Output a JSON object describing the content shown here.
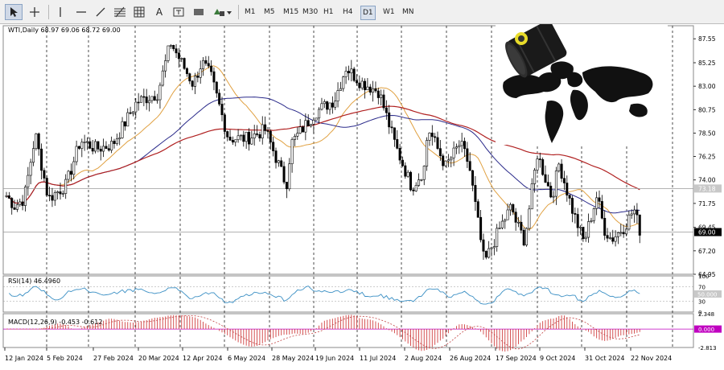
{
  "toolbar": {
    "icons": [
      "cursor-icon",
      "crosshair-icon",
      "vertical-line-icon",
      "horizontal-line-icon",
      "trendline-icon",
      "fibonacci-icon",
      "grid-icon",
      "text-icon",
      "text-label-icon",
      "rectangle-icon",
      "shapes-icon"
    ],
    "timeframes": [
      "M1",
      "M5",
      "M15",
      "M30",
      "H1",
      "H4",
      "D1",
      "W1",
      "MN"
    ],
    "active_timeframe": "D1"
  },
  "main": {
    "header": "WTI,Daily  68.97 69.06 68.72 69.00",
    "price_labels": [
      "87.55",
      "85.25",
      "83.00",
      "80.75",
      "78.50",
      "76.25",
      "74.00",
      "71.75",
      "69.45",
      "67.20",
      "64.95"
    ],
    "marker_label": "73.18",
    "current_label": "69.00"
  },
  "rsi": {
    "header": "RSI(14) 46.4960",
    "labels": [
      "100",
      "70",
      "50.000",
      "30",
      "0"
    ]
  },
  "macd": {
    "header": "MACD(12,26,9) -0.453 -0.612",
    "labels": [
      "2.348",
      "0.000",
      "-2.813"
    ]
  },
  "x_labels": [
    "12 Jan 2024",
    "5 Feb 2024",
    "27 Feb 2024",
    "20 Mar 2024",
    "12 Apr 2024",
    "6 May 2024",
    "28 May 2024",
    "19 Jun 2024",
    "11 Jul 2024",
    "2 Aug 2024",
    "26 Aug 2024",
    "17 Sep 2024",
    "9 Oct 2024",
    "31 Oct 2024",
    "22 Nov 2024"
  ],
  "colors": {
    "ma_orange": "#e0a040",
    "ma_blue": "#2a2a8a",
    "ma_red": "#b02020",
    "rsi": "#3a8fc4",
    "macd_hist": "#d04040",
    "macd_signal": "#c04040"
  },
  "chart_data": {
    "type": "candlestick",
    "symbol": "WTI",
    "timeframe": "Daily",
    "ylim": [
      64.95,
      88.8
    ],
    "close_series": [
      {
        "date": "12 Jan 2024",
        "close": 72.2
      },
      {
        "date": "5 Feb 2024",
        "close": 73.5
      },
      {
        "date": "27 Feb 2024",
        "close": 77.4
      },
      {
        "date": "20 Mar 2024",
        "close": 82.3
      },
      {
        "date": "12 Apr 2024",
        "close": 85.3
      },
      {
        "date": "6 May 2024",
        "close": 78.0
      },
      {
        "date": "28 May 2024",
        "close": 77.5
      },
      {
        "date": "19 Jun 2024",
        "close": 81.7
      },
      {
        "date": "11 Jul 2024",
        "close": 82.5
      },
      {
        "date": "2 Aug 2024",
        "close": 75.0
      },
      {
        "date": "26 Aug 2024",
        "close": 75.5
      },
      {
        "date": "17 Sep 2024",
        "close": 70.2
      },
      {
        "date": "9 Oct 2024",
        "close": 75.6
      },
      {
        "date": "31 Oct 2024",
        "close": 69.3
      },
      {
        "date": "22 Nov 2024",
        "close": 69.0
      }
    ],
    "last": 69.0,
    "horizontal_level": 73.18,
    "rsi_last": 46.496,
    "macd_last": [
      -0.453,
      -0.612
    ]
  }
}
